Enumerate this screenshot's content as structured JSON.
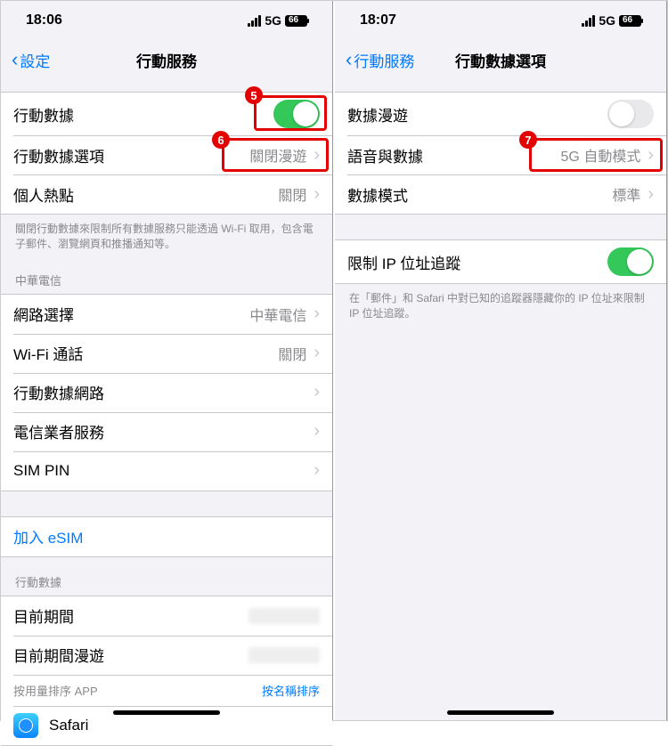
{
  "left": {
    "time": "18:06",
    "net": "5G",
    "battery": "66",
    "back": "設定",
    "title": "行動服務",
    "rows": {
      "mobile_data": "行動數據",
      "options": "行動數據選項",
      "options_val": "關閉漫遊",
      "hotspot": "個人熱點",
      "hotspot_val": "關閉"
    },
    "note1": "關閉行動數據來限制所有數據服務只能透過 Wi-Fi 取用，包含電子郵件、瀏覽網頁和推播通知等。",
    "carrier_header": "中華電信",
    "rows2": {
      "network_sel": "網路選擇",
      "network_sel_val": "中華電信",
      "wifi_call": "Wi-Fi 通話",
      "wifi_call_val": "關閉",
      "data_net": "行動數據網路",
      "carrier_services": "電信業者服務",
      "sim_pin": "SIM PIN"
    },
    "add_esim": "加入 eSIM",
    "usage_header": "行動數據",
    "period": "目前期間",
    "period_roaming": "目前期間漫遊",
    "sort_label": "按用量排序 APP",
    "sort_link": "按名稱排序",
    "safari": "Safari"
  },
  "right": {
    "time": "18:07",
    "net": "5G",
    "battery": "66",
    "back": "行動服務",
    "title": "行動數據選項",
    "roaming": "數據漫遊",
    "voice_data": "語音與數據",
    "voice_data_val": "5G 自動模式",
    "data_mode": "數據模式",
    "data_mode_val": "標準",
    "limit_ip": "限制 IP 位址追蹤",
    "note2": "在「郵件」和 Safari 中對已知的追蹤器隱藏你的 IP 位址來限制 IP 位址追蹤。"
  },
  "badges": {
    "b5": "5",
    "b6": "6",
    "b7": "7"
  }
}
